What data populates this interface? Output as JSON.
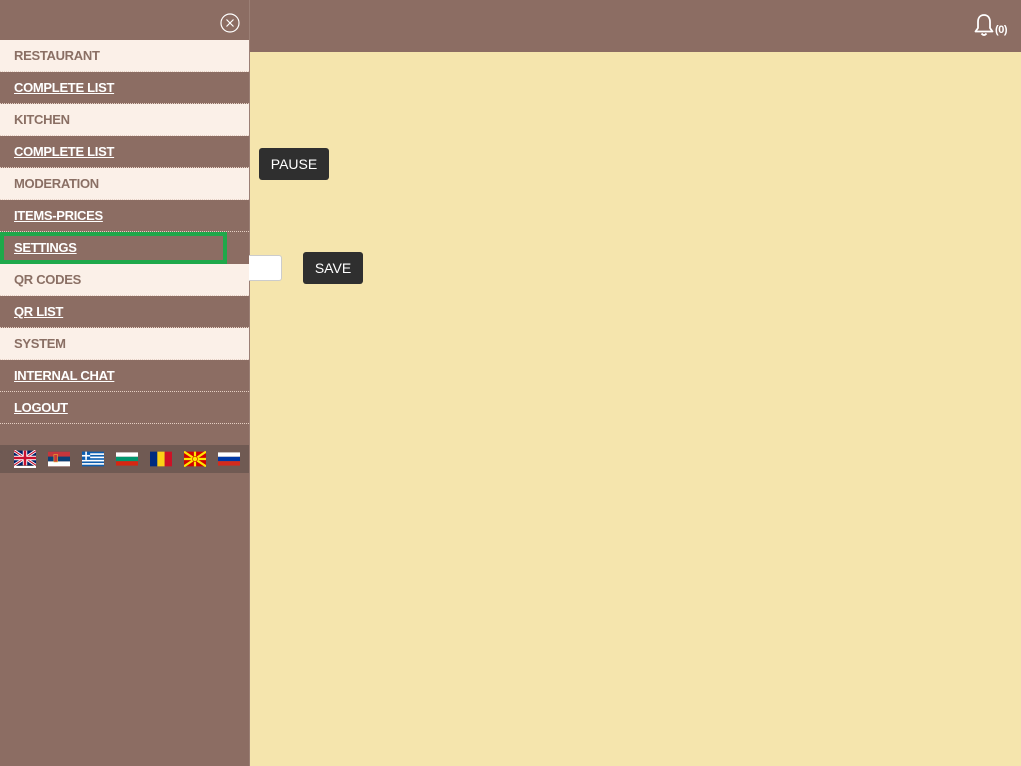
{
  "header": {
    "notification_icon": "bell-icon",
    "notification_count": "(0)"
  },
  "sidebar": {
    "close_icon": "close-icon",
    "items": [
      {
        "label": "RESTAURANT",
        "type": "section"
      },
      {
        "label": "COMPLETE LIST",
        "type": "link"
      },
      {
        "label": "KITCHEN",
        "type": "section"
      },
      {
        "label": "COMPLETE LIST",
        "type": "link"
      },
      {
        "label": "MODERATION",
        "type": "section"
      },
      {
        "label": "ITEMS-PRICES",
        "type": "link"
      },
      {
        "label": "SETTINGS",
        "type": "link",
        "active": true
      },
      {
        "label": "QR CODES",
        "type": "section"
      },
      {
        "label": "QR LIST",
        "type": "link"
      },
      {
        "label": "SYSTEM",
        "type": "section"
      },
      {
        "label": "INTERNAL CHAT",
        "type": "link"
      },
      {
        "label": "LOGOUT",
        "type": "link"
      }
    ],
    "languages": [
      "uk-flag-icon",
      "serbia-flag-icon",
      "greece-flag-icon",
      "bulgaria-flag-icon",
      "romania-flag-icon",
      "macedonia-flag-icon",
      "russia-flag-icon"
    ]
  },
  "main": {
    "pause_label": "PAUSE",
    "input_value": "",
    "save_label": "SAVE"
  },
  "colors": {
    "header_bg": "#8c6d63",
    "content_bg": "#f5e5ad",
    "active_outline": "#1fa84a",
    "button_bg": "#2f2f2f"
  }
}
